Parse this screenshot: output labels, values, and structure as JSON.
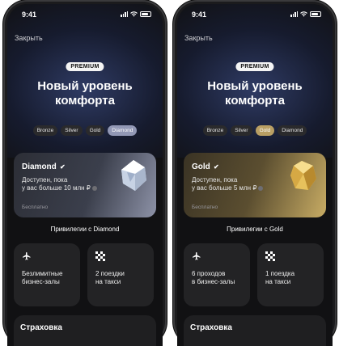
{
  "phones": [
    {
      "status_time": "9:41",
      "close_label": "Закрыть",
      "badge": "PREMIUM",
      "headline_line1": "Новый уровень",
      "headline_line2": "комфорта",
      "tabs": [
        "Bronze",
        "Silver",
        "Gold",
        "Diamond"
      ],
      "active_tab": "Diamond",
      "card_title": "Diamond",
      "card_desc_line1": "Доступен, пока",
      "card_desc_line2": "у вас больше 10 млн ₽",
      "card_foot": "Бесплатно",
      "privileges_title": "Привилегии с Diamond",
      "privileges": [
        {
          "icon": "airplane-icon",
          "line1": "Безлимитные",
          "line2": "бизнес-залы"
        },
        {
          "icon": "taxi-icon",
          "line1": "2 поездки",
          "line2": "на такси"
        }
      ],
      "insurance_label": "Страховка"
    },
    {
      "status_time": "9:41",
      "close_label": "Закрыть",
      "badge": "PREMIUM",
      "headline_line1": "Новый уровень",
      "headline_line2": "комфорта",
      "tabs": [
        "Bronze",
        "Silver",
        "Gold",
        "Diamond"
      ],
      "active_tab": "Gold",
      "card_title": "Gold",
      "card_desc_line1": "Доступен, пока",
      "card_desc_line2": "у вас больше 5 млн ₽",
      "card_foot": "Бесплатно",
      "privileges_title": "Привилегии с Gold",
      "privileges": [
        {
          "icon": "airplane-icon",
          "line1": "6 проходов",
          "line2": "в бизнес-залы"
        },
        {
          "icon": "taxi-icon",
          "line1": "1 поездка",
          "line2": "на такси"
        }
      ],
      "insurance_label": "Страховка"
    }
  ],
  "colors": {
    "diamond_accent": "#9298b5",
    "gold_accent": "#b99f63",
    "background": "#111113"
  }
}
